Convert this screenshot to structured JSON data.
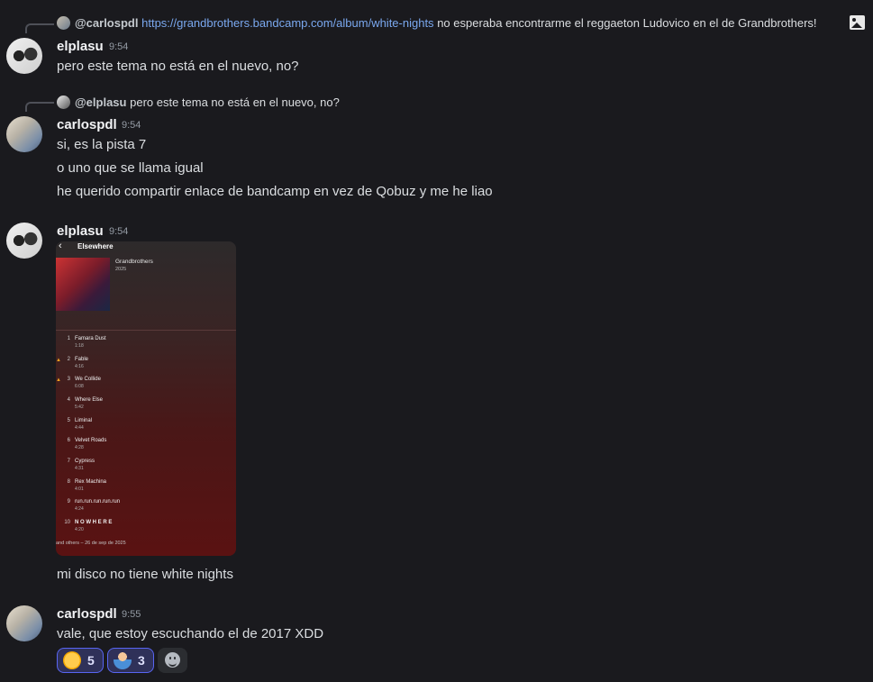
{
  "reply1": {
    "user": "@carlospdl",
    "link": "https://grandbrothers.bandcamp.com/album/white-nights",
    "text": "no esperaba encontrarme el reggaeton Ludovico en el de Grandbrothers!"
  },
  "msg1": {
    "user": "elplasu",
    "time": "9:54",
    "lines": [
      "pero este tema no está en el nuevo, no?"
    ]
  },
  "reply2": {
    "user": "@elplasu",
    "text": "pero este tema no está en el nuevo, no?"
  },
  "msg2": {
    "user": "carlospdl",
    "time": "9:54",
    "lines": [
      "si, es la pista 7",
      "o uno que se llama igual",
      "he querido compartir enlace de bandcamp en vez de Qobuz y me he liao"
    ]
  },
  "msg3": {
    "user": "elplasu",
    "time": "9:54",
    "image": {
      "title": "Elsewhere",
      "artist": "Grandbrothers",
      "year": "2025",
      "tracks": [
        {
          "n": "1",
          "name": "Famara Dust",
          "dur": "1:18",
          "fire": false
        },
        {
          "n": "2",
          "name": "Fable",
          "dur": "4:16",
          "fire": true
        },
        {
          "n": "3",
          "name": "We Collide",
          "dur": "6:08",
          "fire": true
        },
        {
          "n": "4",
          "name": "Where Else",
          "dur": "5:42",
          "fire": false
        },
        {
          "n": "5",
          "name": "Liminal",
          "dur": "4:44",
          "fire": false
        },
        {
          "n": "6",
          "name": "Velvet Roads",
          "dur": "4:28",
          "fire": false
        },
        {
          "n": "7",
          "name": "Cypress",
          "dur": "4:31",
          "fire": false
        },
        {
          "n": "8",
          "name": "Rex Machina",
          "dur": "4:01",
          "fire": false
        },
        {
          "n": "9",
          "name": "run.run.run.run.run",
          "dur": "4:24",
          "fire": false
        },
        {
          "n": "10",
          "name": "N O W H E R E",
          "dur": "4:20",
          "fire": false
        }
      ],
      "footer": "and others – 26 de sep de 2025"
    },
    "text": "mi disco no tiene white nights"
  },
  "msg4": {
    "user": "carlospdl",
    "time": "9:55",
    "lines": [
      "vale, que estoy escuchando el de 2017 XDD"
    ]
  },
  "reactions": [
    {
      "emoji": "rofl-emoji",
      "count": "5"
    },
    {
      "emoji": "person-bowing-emoji",
      "count": "3"
    }
  ],
  "colors": {
    "accent": "#5865f2",
    "link": "#7aa8ef",
    "background": "#1a1a1e"
  }
}
